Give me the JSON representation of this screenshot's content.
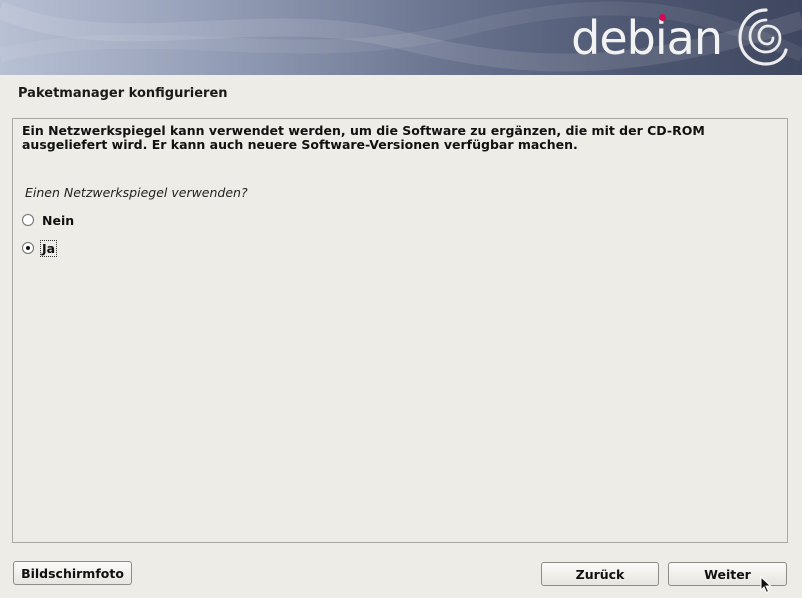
{
  "banner": {
    "brand_name": "debian",
    "logo_icon": "debian-swirl-icon",
    "accent_color": "#d70751"
  },
  "section_title": "Paketmanager konfigurieren",
  "description": "Ein Netzwerkspiegel kann verwendet werden, um die Software zu ergänzen, die mit der CD-ROM ausgeliefert wird. Er kann auch neuere Software-Versionen verfügbar machen.",
  "question": "Einen Netzwerkspiegel verwenden?",
  "options": [
    {
      "label": "Nein",
      "selected": false
    },
    {
      "label": "Ja",
      "selected": true
    }
  ],
  "buttons": {
    "screenshot": "Bildschirmfoto",
    "back": "Zurück",
    "continue": "Weiter"
  }
}
